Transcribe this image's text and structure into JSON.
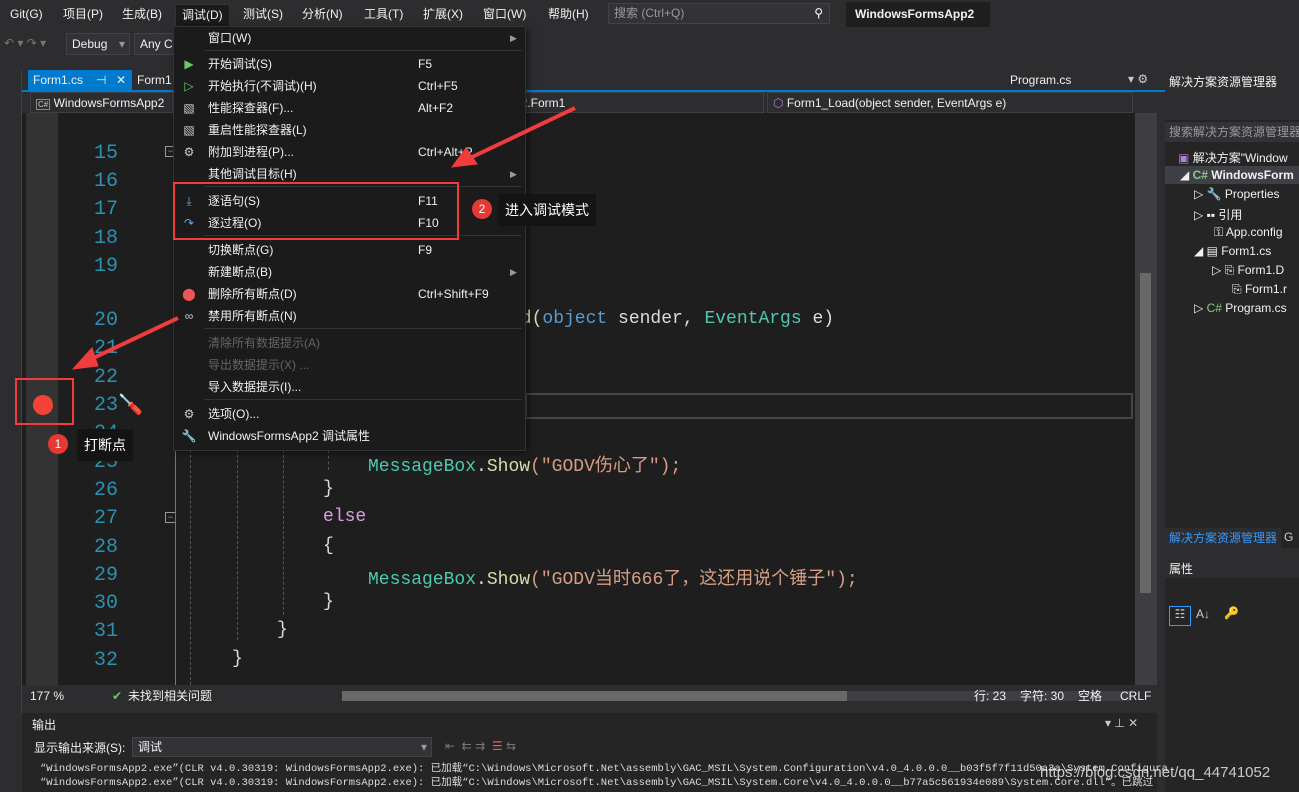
{
  "menubar": {
    "items": [
      "Git(G)",
      "项目(P)",
      "生成(B)",
      "调试(D)",
      "测试(S)",
      "分析(N)",
      "工具(T)",
      "扩展(X)",
      "窗口(W)",
      "帮助(H)"
    ],
    "search_placeholder": "搜索 (Ctrl+Q)",
    "window_title": "WindowsFormsApp2"
  },
  "toolbar": {
    "config": "Debug",
    "platform": "Any C"
  },
  "tabs": {
    "active": "Form1.cs",
    "second": "Form1",
    "right": "Program.cs"
  },
  "navbar": {
    "project": "WindowsFormsApp2",
    "class": "p2.Form1",
    "member": "Form1_Load(object sender, EventArgs e)"
  },
  "debug_menu": [
    {
      "label": "窗口(W)",
      "shortcut": "",
      "submenu": true,
      "icon": ""
    },
    {
      "label": "开始调试(S)",
      "shortcut": "F5",
      "icon": "play-icon"
    },
    {
      "label": "开始执行(不调试)(H)",
      "shortcut": "Ctrl+F5",
      "icon": "play-outline-icon"
    },
    {
      "label": "性能探查器(F)...",
      "shortcut": "Alt+F2",
      "icon": "chart-icon"
    },
    {
      "label": "重启性能探查器(L)",
      "shortcut": "",
      "icon": "chart-icon"
    },
    {
      "label": "附加到进程(P)...",
      "shortcut": "Ctrl+Alt+P",
      "icon": "gears-icon"
    },
    {
      "label": "其他调试目标(H)",
      "shortcut": "",
      "submenu": true,
      "icon": ""
    },
    {
      "label": "逐语句(S)",
      "shortcut": "F11",
      "icon": "step-into-icon"
    },
    {
      "label": "逐过程(O)",
      "shortcut": "F10",
      "icon": "step-over-icon"
    },
    {
      "label": "切换断点(G)",
      "shortcut": "F9",
      "icon": ""
    },
    {
      "label": "新建断点(B)",
      "shortcut": "",
      "submenu": true,
      "icon": ""
    },
    {
      "label": "删除所有断点(D)",
      "shortcut": "Ctrl+Shift+F9",
      "icon": "delete-breakpoints-icon"
    },
    {
      "label": "禁用所有断点(N)",
      "shortcut": "",
      "icon": "disable-breakpoints-icon"
    },
    {
      "label": "清除所有数据提示(A)",
      "shortcut": "",
      "disabled": true,
      "icon": ""
    },
    {
      "label": "导出数据提示(X) ...",
      "shortcut": "",
      "disabled": true,
      "icon": ""
    },
    {
      "label": "导入数据提示(I)...",
      "shortcut": "",
      "icon": ""
    },
    {
      "label": "选项(O)...",
      "shortcut": "",
      "icon": "gear-icon"
    },
    {
      "label": "WindowsFormsApp2 调试属性",
      "shortcut": "",
      "icon": "wrench-icon"
    }
  ],
  "editor": {
    "line_numbers": [
      "15",
      "16",
      "17",
      "18",
      "19",
      "20",
      "21",
      "22",
      "23",
      "24",
      "25",
      "26",
      "27",
      "28",
      "29",
      "30",
      "31",
      "32"
    ],
    "line20_visible": {
      "a": "ad(",
      "b": "object",
      "c": " sender, ",
      "d": "EventArgs",
      "e": " e)"
    },
    "line25": {
      "cls": "MessageBox",
      "dot": ".",
      "m": "Show",
      "s": "(\"GODV伤心了\");"
    },
    "line26": "}",
    "line27": "else",
    "line28": "{",
    "line29": {
      "cls": "MessageBox",
      "dot": ".",
      "m": "Show",
      "s": "(\"GODV当时666了，这还用说个锤子\");"
    },
    "line30": "}",
    "line31": "}",
    "line32": "}",
    "breakpoint_line": "23"
  },
  "annotations": {
    "badge1": "1",
    "tip1": "打断点",
    "badge2": "2",
    "tip2": "进入调试模式",
    "accent": "#f03c3c"
  },
  "statusbar": {
    "zoom": "177 %",
    "issues": "未找到相关问题",
    "line": "行: 23",
    "char": "字符: 30",
    "spaces": "空格",
    "eol": "CRLF"
  },
  "solution_explorer": {
    "title": "解决方案资源管理器",
    "search_placeholder": "搜索解决方案资源管理器",
    "items": [
      "解决方案\"Window",
      "WindowsForm",
      "Properties",
      "引用",
      "App.config",
      "Form1.cs",
      "Form1.D",
      "Form1.r",
      "Program.cs"
    ],
    "tab": "解决方案资源管理器",
    "tab2": "G"
  },
  "properties": {
    "title": "属性"
  },
  "output": {
    "title": "输出",
    "source_label": "显示输出来源(S):",
    "source_value": "调试",
    "lines": [
      "“WindowsFormsApp2.exe”(CLR v4.0.30319: WindowsFormsApp2.exe): 已加载“C:\\Windows\\Microsoft.Net\\assembly\\GAC_MSIL\\System.Configuration\\v4.0_4.0.0.0__b03f5f7f11d50a3a\\System.Configura",
      "“WindowsFormsApp2.exe”(CLR v4.0.30319: WindowsFormsApp2.exe): 已加载“C:\\Windows\\Microsoft.Net\\assembly\\GAC_MSIL\\System.Core\\v4.0_4.0.0.0__b77a5c561934e089\\System.Core.dll”。已跳过"
    ]
  },
  "watermark": "https://blog.csdn.net/qq_44741052"
}
